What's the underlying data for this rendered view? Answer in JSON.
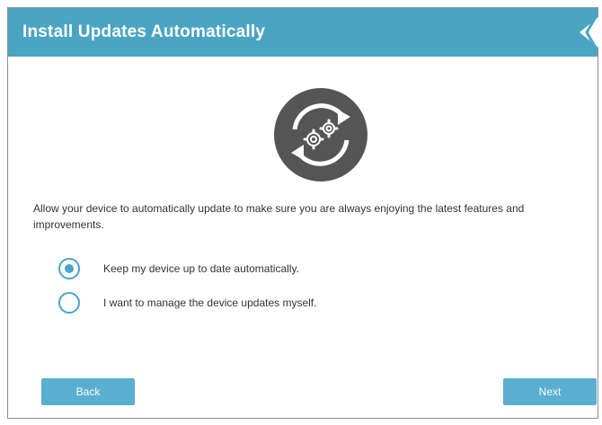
{
  "header": {
    "title": "Install Updates Automatically"
  },
  "main": {
    "icon": "update-gears-icon",
    "description": "Allow your device to automatically update to make sure you are always enjoying the latest features and improvements.",
    "options": [
      {
        "label": "Keep my device up to date automatically.",
        "selected": true
      },
      {
        "label": "I want to manage the device updates myself.",
        "selected": false
      }
    ]
  },
  "footer": {
    "back_label": "Back",
    "next_label": "Next"
  },
  "colors": {
    "accent": "#4aa5c3",
    "button": "#5aaed0",
    "icon_dark": "#555555"
  }
}
